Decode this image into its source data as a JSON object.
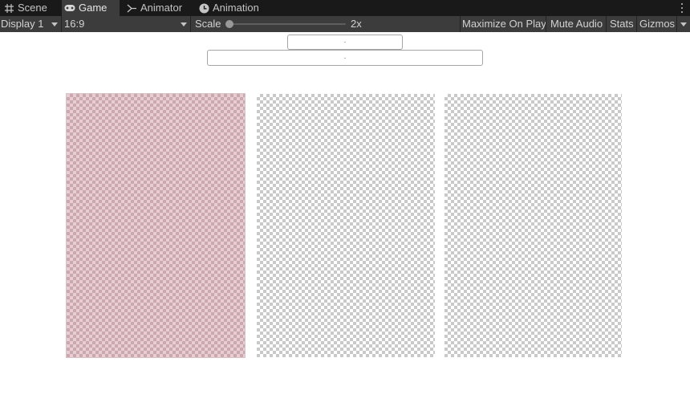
{
  "tabs": [
    {
      "label": "Scene",
      "icon": "grid-icon",
      "active": false
    },
    {
      "label": "Game",
      "icon": "gamepad-icon",
      "active": true
    },
    {
      "label": "Animator",
      "icon": "animator-icon",
      "active": false
    },
    {
      "label": "Animation",
      "icon": "clock-icon",
      "active": false
    }
  ],
  "toolbar": {
    "display": "Display 1",
    "aspect": "16:9",
    "scale_label": "Scale",
    "scale_value": "2x",
    "scale_fraction": 0.0,
    "maximize_on_play": "Maximize On Play",
    "mute_audio": "Mute Audio",
    "stats": "Stats",
    "gizmos": "Gizmos"
  },
  "fields": [
    {
      "text": "-"
    },
    {
      "text": "-"
    }
  ],
  "cards": [
    {
      "state": "selected"
    },
    {
      "state": "normal"
    },
    {
      "state": "normal"
    }
  ],
  "colors": {
    "tabbar_bg": "#191919",
    "toolbar_bg": "#3c3c3c",
    "selected_tint": "#cda7ad"
  }
}
